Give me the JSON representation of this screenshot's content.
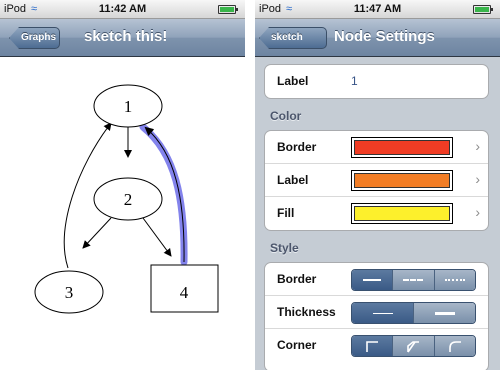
{
  "left_screen": {
    "status": {
      "carrier": "iPod",
      "time": "11:42 AM"
    },
    "nav": {
      "back_label": "Graphs",
      "title": "sketch this!"
    },
    "graph": {
      "nodes": [
        {
          "label": "1"
        },
        {
          "label": "2"
        },
        {
          "label": "3"
        },
        {
          "label": "4"
        }
      ],
      "highlight_color": "#5a5ae6"
    }
  },
  "right_screen": {
    "status": {
      "carrier": "iPod",
      "time": "11:47 AM"
    },
    "nav": {
      "back_label": "sketch this!",
      "title": "Node Settings"
    },
    "label_row": {
      "label": "Label",
      "value": "1"
    },
    "color_section": {
      "header": "Color",
      "rows": [
        {
          "label": "Border",
          "color": "#f03c24"
        },
        {
          "label": "Label",
          "color": "#f27d25"
        },
        {
          "label": "Fill",
          "color": "#fdf02c"
        }
      ]
    },
    "style_section": {
      "header": "Style",
      "rows": [
        {
          "label": "Border",
          "options": [
            "solid-line-icon",
            "dashed-line-icon",
            "dotted-line-icon"
          ],
          "selected": 0
        },
        {
          "label": "Thickness",
          "options": [
            "thin-line-icon",
            "thick-line-icon"
          ],
          "selected": 0
        },
        {
          "label": "Corner",
          "options": [
            "square-corner-icon",
            "bevel-corner-icon",
            "round-corner-icon"
          ],
          "selected": 0
        }
      ]
    }
  }
}
